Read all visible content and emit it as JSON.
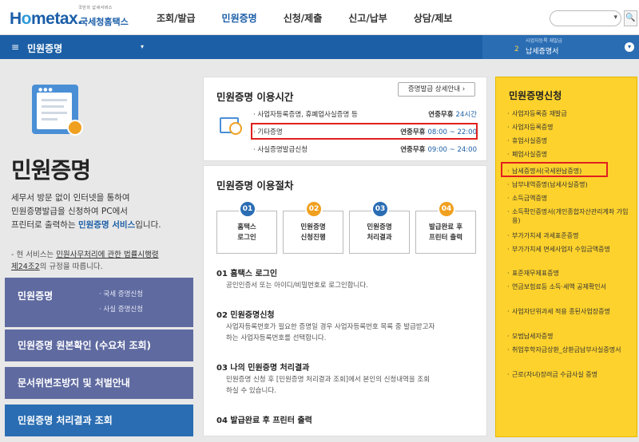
{
  "header": {
    "logo_small": "국민의 납세서비스",
    "logo_main_1": "H",
    "logo_main_o": "o",
    "logo_main_2": "metax.",
    "logo_sub": "국세청홈택스",
    "nav": [
      "조회/발급",
      "민원증명",
      "신청/제출",
      "신고/납부",
      "상담/제보"
    ],
    "search_dropdown": "▾",
    "search_icon": "🔍"
  },
  "bluebar": {
    "menu_icon": "≡",
    "title": "민원증명",
    "dropdown": "▾",
    "right_small": "사업자등록 재발급",
    "right_num": "2",
    "right_text": "납세증명서",
    "right_icon": "▾"
  },
  "hero": {
    "title": "민원증명",
    "desc_1": "세무서 방문 없이 인터넷을 통하여",
    "desc_2": "민원증명발급을 신청하여 PC에서",
    "desc_3a": "프린터로 출력하는 ",
    "desc_3b": "민원증명 서비스",
    "desc_3c": "입니다.",
    "note_1": "- 현 서비스는 ",
    "note_1u": "민원사무처리에 관한 법률시행령",
    "note_2u": "제24조2",
    "note_2": "의 규정을 따릅니다."
  },
  "left_menu": {
    "box1_title": "민원증명",
    "box1_sub1": "· 국세 증명신청",
    "box1_sub2": "· 사실 증명신청",
    "box2": "민원증명 원본확인 (수요처 조회)",
    "box3": "문서위변조방지 및 처벌안내",
    "box4": "민원증명 처리결과 조회"
  },
  "hours": {
    "title": "민원증명 이용시간",
    "detail_button": "증명발급 상세안내 ›",
    "rows": [
      {
        "label": "· 사업자등록증명, 휴폐업사실증명 등",
        "r1": "연중무휴 ",
        "r2": "24시간"
      },
      {
        "label": "· 기타증명",
        "r1": "연중무휴 ",
        "r2": "08:00 ~ 22:00"
      },
      {
        "label": "· 사실증명발급신청",
        "r1": "연중무휴 ",
        "r2": "09:00 ~ 24:00"
      }
    ]
  },
  "procedure": {
    "title": "민원증명 이용절차",
    "steps": [
      {
        "num": "01",
        "l1": "홈택스",
        "l2": "로그인",
        "color": "#2a6db3"
      },
      {
        "num": "02",
        "l1": "민원증명",
        "l2": "신청진행",
        "color": "#f0a020"
      },
      {
        "num": "03",
        "l1": "민원증명",
        "l2": "처리결과",
        "color": "#2a6db3"
      },
      {
        "num": "04",
        "l1": "발급완료 후",
        "l2": "프린터 출력",
        "color": "#f0a020"
      }
    ],
    "s1_h": "01 홈택스 로그인",
    "s1_p": "공인인증서 또는 아이디/비밀번호로 로그인합니다.",
    "s2_h": "02 민원증명신청",
    "s2_p1": "사업자등록번호가 필요한 증명일 경우 사업자등록번호 목록 중 발급받고자",
    "s2_p2": "하는 사업자등록번호를 선택합니다.",
    "s3_h": "03 나의 민원증명 처리결과",
    "s3_p1": "민원증명 신청 후 [민원증명 처리결과 조회]에서 본인의 신청내역을 조회",
    "s3_p2": "하실 수 있습니다.",
    "s4_h": "04 발급완료 후 프린터 출력"
  },
  "yellow": {
    "title": "민원증명신청",
    "items": [
      "사업자등록증 재발급",
      "사업자등록증명",
      "휴업사실증명",
      "폐업사실증명",
      "납세증명서(국세완납증명)",
      "납부내역증명(납세사실증명)",
      "소득금액증명",
      "소득확인증명서(개인종합자산관리계좌 가입용)",
      "부가가치세 과세표준증명",
      "부가가치세 면세사업자 수입금액증명",
      "표준재무제표증명",
      "연금보험료등 소득·세액 공제확인서",
      "사업자단위과세 적용 종된사업장증명",
      "모범납세자증명",
      "취업후학자금상환_상환금납부사실증명서",
      "근로(자녀)장려금 수급사실 증명"
    ]
  }
}
